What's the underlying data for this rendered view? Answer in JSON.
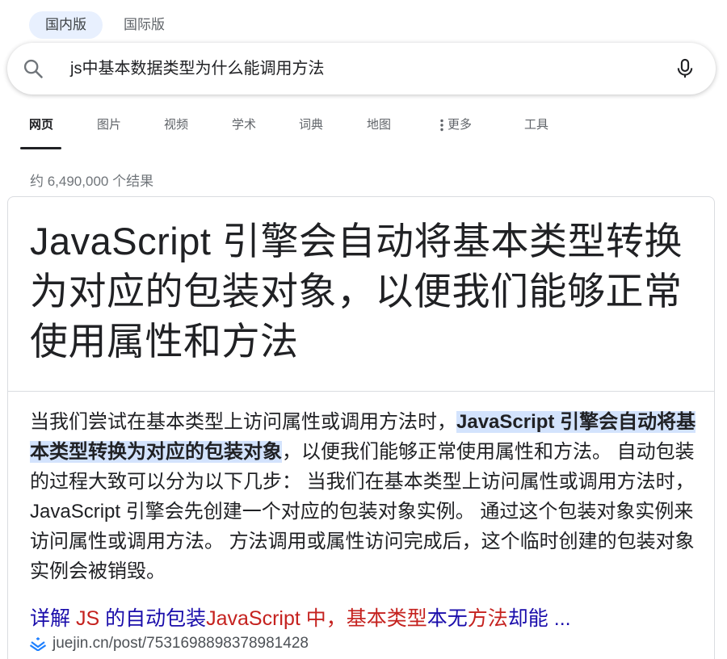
{
  "region_tabs": [
    {
      "label": "国内版",
      "active": true
    },
    {
      "label": "国际版",
      "active": false
    }
  ],
  "search": {
    "query": "js中基本数据类型为什么能调用方法",
    "search_icon": "search-icon",
    "mic_icon": "microphone-icon"
  },
  "nav": {
    "items": [
      "网页",
      "图片",
      "视频",
      "学术",
      "词典",
      "地图",
      "更多",
      "工具"
    ],
    "active": "网页",
    "more_icon": "vertical-dots-icon"
  },
  "result_count": "约 6,490,000 个结果",
  "answer": {
    "title": "JavaScript 引擎会自动将基本类型转换为对应的包装对象，以便我们能够正常使用属性和方法",
    "snippet_before": "当我们尝试在基本类型上访问属性或调用方法时，",
    "snippet_highlight": "JavaScript 引擎会自动将基本类型转换为对应的包装对象",
    "snippet_after": "，以便我们能够正常使用属性和方法。 自动包装的过程大致可以分为以下几步： 当我们在基本类型上访问属性或调用方法时，JavaScript 引擎会先创建一个对应的包装对象实例。 通过这个包装对象实例来访问属性或调用方法。 方法调用或属性访问完成后，这个临时创建的包装对象实例会被销毁。"
  },
  "source": {
    "title_parts": [
      {
        "text": "详解 ",
        "style": "blue"
      },
      {
        "text": "JS",
        "style": "red"
      },
      {
        "text": " 的自动包装",
        "style": "blue"
      },
      {
        "text": "JavaScript 中，基本类型",
        "style": "red"
      },
      {
        "text": "本无",
        "style": "blue"
      },
      {
        "text": "方法",
        "style": "red"
      },
      {
        "text": "却能 ...",
        "style": "blue"
      }
    ],
    "url": "juejin.cn/post/7531698898378981428",
    "favicon": "juejin-logo-icon"
  },
  "colors": {
    "link_blue": "#1a0dab",
    "keyword_red": "#c5221f",
    "highlight_bg": "#d3e3fd",
    "active_tab_bg": "#e8f0fe"
  }
}
